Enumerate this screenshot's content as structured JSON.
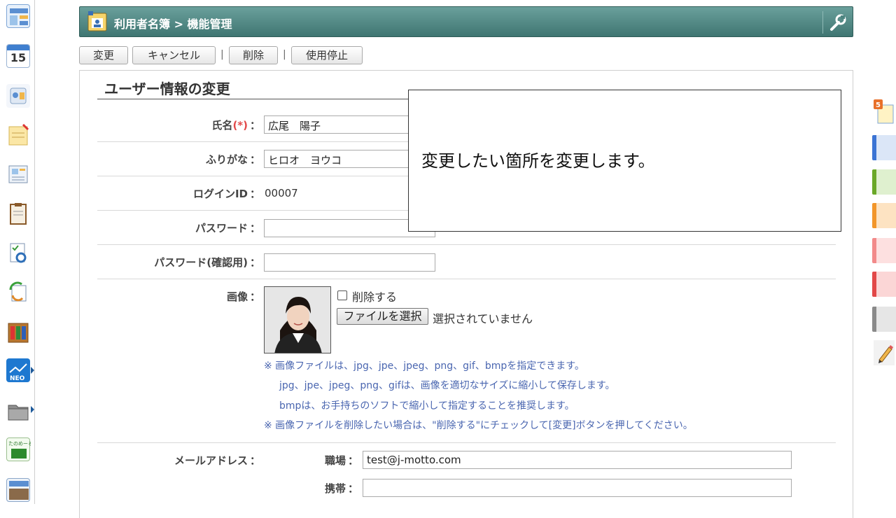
{
  "header": {
    "title": "利用者名簿 > 機能管理"
  },
  "toolbar": {
    "change": "変更",
    "cancel": "キャンセル",
    "sep1": "|",
    "delete": "削除",
    "sep2": "|",
    "suspend": "使用停止"
  },
  "form": {
    "title": "ユーザー情報の変更",
    "name_label": "氏名",
    "required_mark": "(*)",
    "colon": "：",
    "name_value": "広尾　陽子",
    "kana_label": "ふりがな",
    "kana_value": "ヒロオ　ヨウコ",
    "login_label": "ログインID",
    "login_value": "00007",
    "password_label": "パスワード",
    "password_value": "",
    "password_confirm_label": "パスワード(確認用)",
    "password_confirm_value": "",
    "image_label": "画像",
    "delete_image_label": "削除する",
    "file_button": "ファイルを選択",
    "file_status": "選択されていません",
    "notes": [
      "※ 画像ファイルは、jpg、jpe、jpeg、png、gif、bmpを指定できます。",
      "jpg、jpe、jpeg、png、gifは、画像を適切なサイズに縮小して保存します。",
      "bmpは、お手持ちのソフトで縮小して指定することを推奨します。",
      "※ 画像ファイルを削除したい場合は、\"削除する\"にチェックして[変更]ボタンを押してください。"
    ],
    "mail_label": "メールアドレス",
    "mail_work_label": "職場",
    "mail_work_value": "test@j-motto.com",
    "mail_mobile_label": "携帯",
    "mail_mobile_value": ""
  },
  "callout": {
    "text": "変更したい箇所を変更します。"
  },
  "sidebar": {
    "calendar_day": "15",
    "badge_count": "5",
    "neo_label": "NEO"
  },
  "colors": {
    "header": "#4f8783",
    "note": "#4a66b0",
    "required": "#e24a4a"
  }
}
